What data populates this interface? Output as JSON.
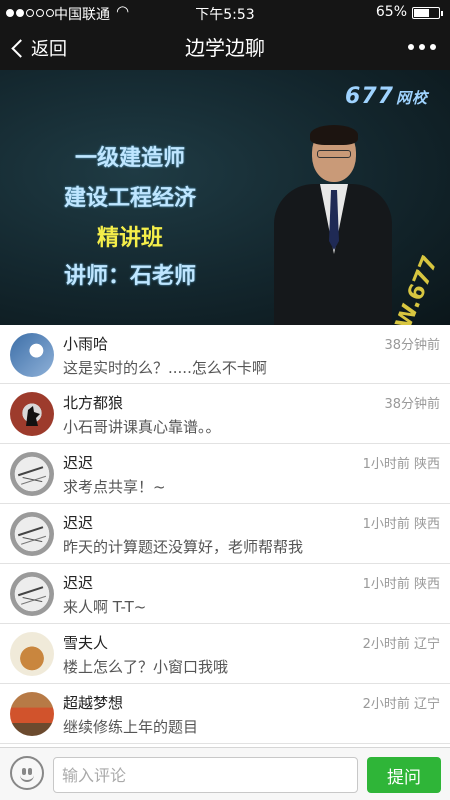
{
  "status_bar": {
    "carrier": "中国联通",
    "time": "下午5:53",
    "battery_percent": "65%",
    "battery_level": 0.65,
    "signal_bars_on": 2,
    "signal_bars_total": 5,
    "icons": [
      "signal-dots-icon",
      "wifi-icon",
      "battery-icon"
    ]
  },
  "nav": {
    "back_label": "返回",
    "title": "边学边聊",
    "more_icon": "more-dots-icon"
  },
  "video": {
    "logo_number": "677",
    "logo_text": "网校",
    "lines": [
      "一级建造师",
      "建设工程经济",
      "精讲班",
      "讲师：石老师"
    ],
    "watermark": "W.677"
  },
  "comments": [
    {
      "name": "小雨哈",
      "meta": "38分钟前",
      "text": "这是实时的么？.....怎么不卡啊",
      "avatar": "avatar-blue-photo"
    },
    {
      "name": "北方都狼",
      "meta": "38分钟前",
      "text": "小石哥讲课真心靠谱。。",
      "avatar": "avatar-wolf-moon"
    },
    {
      "name": "迟迟",
      "meta": "1小时前 陕西",
      "text": "求考点共享！~",
      "avatar": "avatar-sketch"
    },
    {
      "name": "迟迟",
      "meta": "1小时前 陕西",
      "text": "昨天的计算题还没算好，老师帮帮我",
      "avatar": "avatar-sketch"
    },
    {
      "name": "迟迟",
      "meta": "1小时前 陕西",
      "text": "来人啊 T-T~",
      "avatar": "avatar-sketch"
    },
    {
      "name": "雪夫人",
      "meta": "2小时前 辽宁",
      "text": "楼上怎么了？小窗口我哦",
      "avatar": "avatar-bear"
    },
    {
      "name": "超越梦想",
      "meta": "2小时前 辽宁",
      "text": "继续修练上年的题目",
      "avatar": "avatar-truck"
    }
  ],
  "input_bar": {
    "emoji_icon": "emoji-icon",
    "placeholder": "输入评论",
    "value": "",
    "submit_label": "提问",
    "submit_color": "#2fb538"
  }
}
